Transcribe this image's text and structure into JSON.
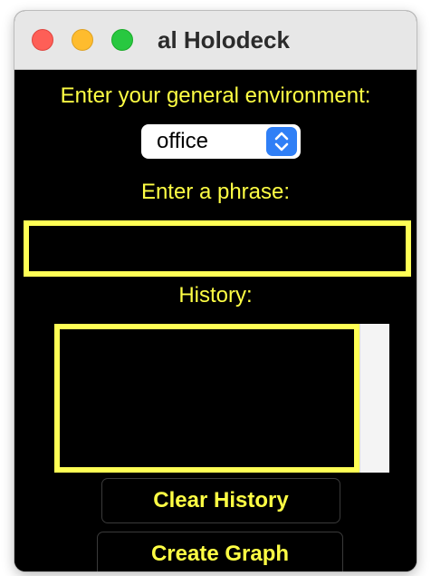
{
  "window": {
    "title": "al Holodeck"
  },
  "environment": {
    "label": "Enter your general environment:",
    "selected": "office"
  },
  "phrase": {
    "label": "Enter a phrase:",
    "value": ""
  },
  "history": {
    "label": "History:",
    "items": []
  },
  "buttons": {
    "clear_history": "Clear History",
    "create_graph": "Create Graph"
  },
  "colors": {
    "text_accent": "#ffff44",
    "background": "#000000",
    "border_accent": "#ffff55",
    "stepper": "#2f7ff6"
  },
  "icons": {
    "window_controls": [
      "close-icon",
      "minimize-icon",
      "zoom-icon"
    ],
    "select": "updown-chevron-icon"
  }
}
